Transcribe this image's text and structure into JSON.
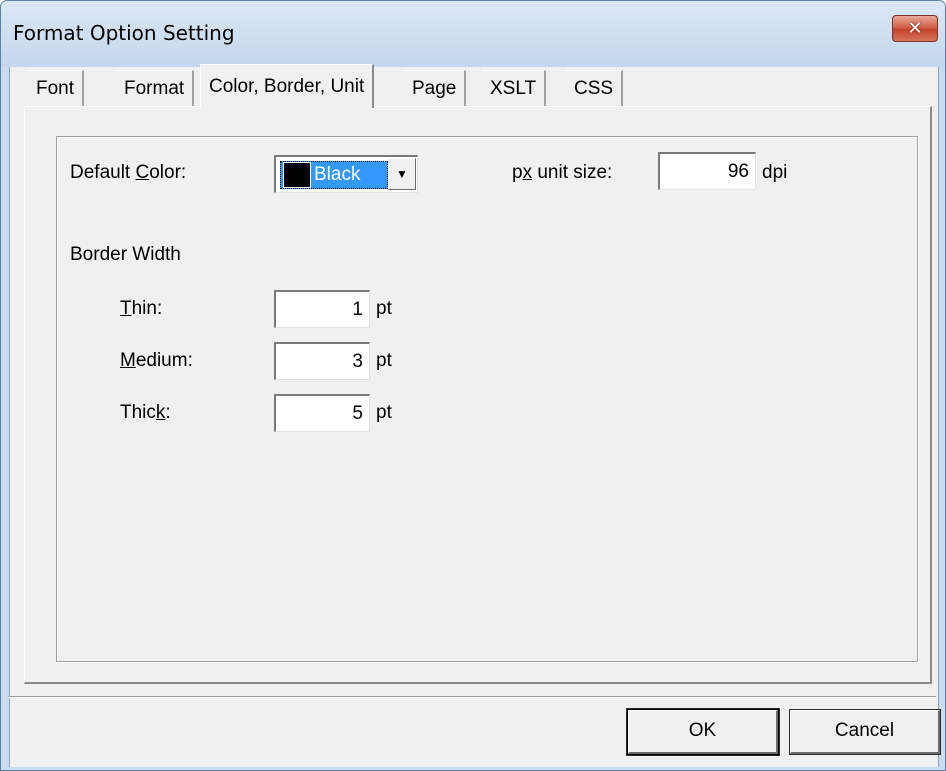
{
  "window": {
    "title": "Format Option Setting",
    "close_label": "✕"
  },
  "tabs": [
    {
      "label": "Font",
      "active": false
    },
    {
      "label": "Format",
      "active": false
    },
    {
      "label": "Color, Border, Unit",
      "active": true
    },
    {
      "label": "Page",
      "active": false
    },
    {
      "label": "XSLT",
      "active": false
    },
    {
      "label": "CSS",
      "active": false
    }
  ],
  "default_color": {
    "label_pre": "Default ",
    "label_mnemonic": "C",
    "label_post": "olor:",
    "selected": "Black",
    "swatch_color": "#000000"
  },
  "px_unit": {
    "label_pre": "p",
    "label_mnemonic": "x",
    "label_post": " unit size:",
    "value": "96",
    "unit": "dpi"
  },
  "border_width": {
    "heading": "Border Width",
    "thin": {
      "label_mnemonic": "T",
      "label_post": "hin:",
      "value": "1",
      "unit": "pt"
    },
    "medium": {
      "label_mnemonic": "M",
      "label_post": "edium:",
      "value": "3",
      "unit": "pt"
    },
    "thick": {
      "label_pre": "Thic",
      "label_mnemonic": "k",
      "label_post": ":",
      "value": "5",
      "unit": "pt"
    }
  },
  "buttons": {
    "ok": "OK",
    "cancel": "Cancel"
  }
}
